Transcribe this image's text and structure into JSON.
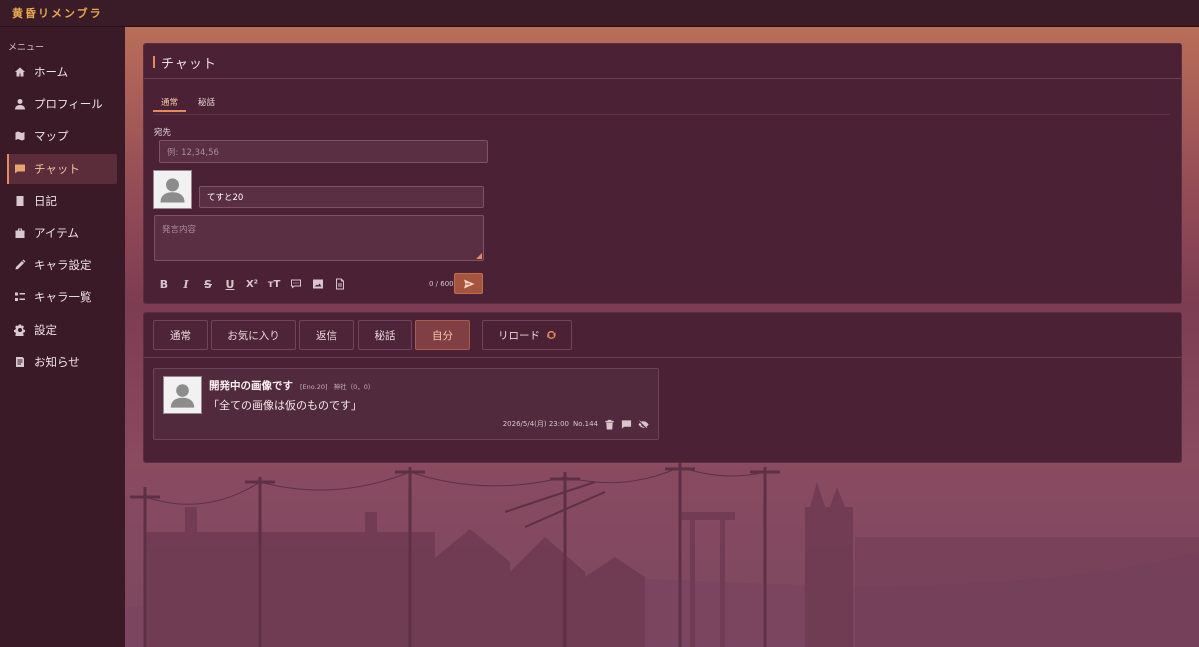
{
  "app": {
    "logo": "黄昏リメンブラ"
  },
  "sidebar": {
    "heading": "メニュー",
    "items": [
      {
        "label": "ホーム",
        "icon": "home-icon"
      },
      {
        "label": "プロフィール",
        "icon": "user-icon"
      },
      {
        "label": "マップ",
        "icon": "map-icon"
      },
      {
        "label": "チャット",
        "icon": "chat-icon",
        "active": true
      },
      {
        "label": "日記",
        "icon": "book-icon"
      },
      {
        "label": "アイテム",
        "icon": "bag-icon"
      },
      {
        "label": "キャラ設定",
        "icon": "pencil-icon"
      },
      {
        "label": "キャラ一覧",
        "icon": "list-icon"
      },
      {
        "label": "設定",
        "icon": "gear-icon"
      },
      {
        "label": "お知らせ",
        "icon": "news-icon"
      }
    ]
  },
  "chat": {
    "title": "チャット",
    "tabs": [
      "通常",
      "秘話"
    ],
    "destination_label": "宛先",
    "destination_placeholder": "例: 12,34,56",
    "name_value": "てすと20",
    "body_placeholder": "発言内容",
    "counter": "0 / 600",
    "toolbar": [
      {
        "name": "bold",
        "glyph": "B"
      },
      {
        "name": "italic",
        "glyph": "I"
      },
      {
        "name": "strikethrough",
        "glyph": "S"
      },
      {
        "name": "underline",
        "glyph": "U"
      },
      {
        "name": "superscript",
        "glyph": "X²"
      },
      {
        "name": "text-size",
        "glyph": "тT"
      }
    ]
  },
  "log": {
    "filters": [
      "通常",
      "お気に入り",
      "返信",
      "秘話",
      "自分"
    ],
    "active_filter": "自分",
    "reload_label": "リロード",
    "messages": [
      {
        "name": "開発中の画像です",
        "eno": "[Eno.20]",
        "location": "神社（0，0）",
        "text": "「全ての画像は仮のものです」",
        "timestamp": "2026/5/4(月) 23:00",
        "number": "No.144"
      }
    ]
  },
  "colors": {
    "accent": "#e58b5b",
    "panel": "#4b2235",
    "sidebar": "#3b1a27",
    "logo": "#e9a84e"
  }
}
